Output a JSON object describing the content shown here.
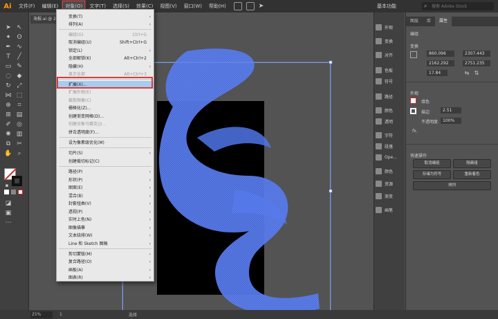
{
  "app": {
    "logo": "Ai",
    "workspace": "基本功能",
    "search_placeholder": "搜索 Adobe Stock"
  },
  "menubar": [
    "文件(F)",
    "编辑(E)",
    "对象(O)",
    "文字(T)",
    "选择(S)",
    "效果(C)",
    "视图(V)",
    "窗口(W)",
    "帮助(H)"
  ],
  "document": {
    "tab": "海报.ai @ 25%"
  },
  "object_menu": {
    "items": [
      {
        "label": "变换(T)",
        "arrow": "›",
        "disabled": false
      },
      {
        "label": "排列(A)",
        "arrow": "›",
        "disabled": false
      },
      {
        "label": "编组(G)",
        "shortcut": "Ctrl+G",
        "disabled": true
      },
      {
        "label": "取消编组(U)",
        "shortcut": "Shift+Ctrl+G",
        "disabled": false
      },
      {
        "label": "锁定(L)",
        "arrow": "›",
        "disabled": false
      },
      {
        "label": "全部解锁(K)",
        "shortcut": "Alt+Ctrl+2",
        "disabled": false
      },
      {
        "label": "隐藏(H)",
        "arrow": "›",
        "disabled": false
      },
      {
        "label": "显示全部",
        "shortcut": "Alt+Ctrl+3",
        "disabled": true
      },
      {
        "label": "扩展(X)...",
        "disabled": false,
        "highlight": true
      },
      {
        "label": "扩展外观(E)",
        "disabled": true
      },
      {
        "label": "裁剪图像(C)",
        "disabled": true
      },
      {
        "label": "栅格化(Z)...",
        "disabled": false
      },
      {
        "label": "创建渐变网格(D)...",
        "disabled": false
      },
      {
        "label": "创建对象马赛克(J)...",
        "disabled": true
      },
      {
        "label": "拼合透明度(F)...",
        "disabled": false
      },
      {
        "label": "设为像素级优化(M)",
        "disabled": false
      },
      {
        "label": "切片(S)",
        "arrow": "›",
        "disabled": false
      },
      {
        "label": "创建裁切标记(C)",
        "disabled": false
      },
      {
        "label": "路径(P)",
        "arrow": "›",
        "disabled": false
      },
      {
        "label": "形状(P)",
        "arrow": "›",
        "disabled": false
      },
      {
        "label": "图案(E)",
        "arrow": "›",
        "disabled": false
      },
      {
        "label": "混合(B)",
        "arrow": "›",
        "disabled": false
      },
      {
        "label": "封套扭曲(V)",
        "arrow": "›",
        "disabled": false
      },
      {
        "label": "透视(P)",
        "arrow": "›",
        "disabled": false
      },
      {
        "label": "实时上色(N)",
        "arrow": "›",
        "disabled": false
      },
      {
        "label": "图像描摹",
        "arrow": "›",
        "disabled": false
      },
      {
        "label": "文本绕排(W)",
        "arrow": "›",
        "disabled": false
      },
      {
        "label": "Line 和 Sketch 图稿",
        "arrow": "›",
        "disabled": false
      },
      {
        "label": "剪切蒙版(M)",
        "arrow": "›",
        "disabled": false
      },
      {
        "label": "复合路径(O)",
        "arrow": "›",
        "disabled": false
      },
      {
        "label": "画板(A)",
        "arrow": "›",
        "disabled": false
      },
      {
        "label": "图表(R)",
        "arrow": "›",
        "disabled": false
      }
    ]
  },
  "dock": [
    "外观",
    "变换",
    "对齐",
    "色板",
    "符号",
    "路径",
    "颜色",
    "透明",
    "字符",
    "段落",
    "Ope...",
    "颜色",
    "资源",
    "渐变",
    "画笔"
  ],
  "properties": {
    "tabs": [
      "图层",
      "库",
      "属性"
    ],
    "section_group": "编组",
    "section_transform": "变换",
    "x": "860.096",
    "y": "2162.292",
    "w": "2307.443",
    "h": "2751.235",
    "angle": "17.84",
    "section_appearance": "外观",
    "fill_label": "填色",
    "stroke_label": "描边",
    "stroke_value": "2.51",
    "opacity_label": "不透明度",
    "opacity_value": "100%",
    "fx": "fx.",
    "section_quick": "快速操作",
    "btn_ungroup": "取消编组",
    "btn_isolate": "隔离组",
    "btn_symbol": "存储为符号",
    "btn_recolor": "重新着色",
    "btn_arrange": "排列"
  },
  "status": {
    "zoom": "25%",
    "artboard": "1",
    "mode": "选择"
  },
  "colors": {
    "shape": "#4f74e8",
    "accent": "#e03a3a",
    "highlight": "#a6ccf0"
  }
}
